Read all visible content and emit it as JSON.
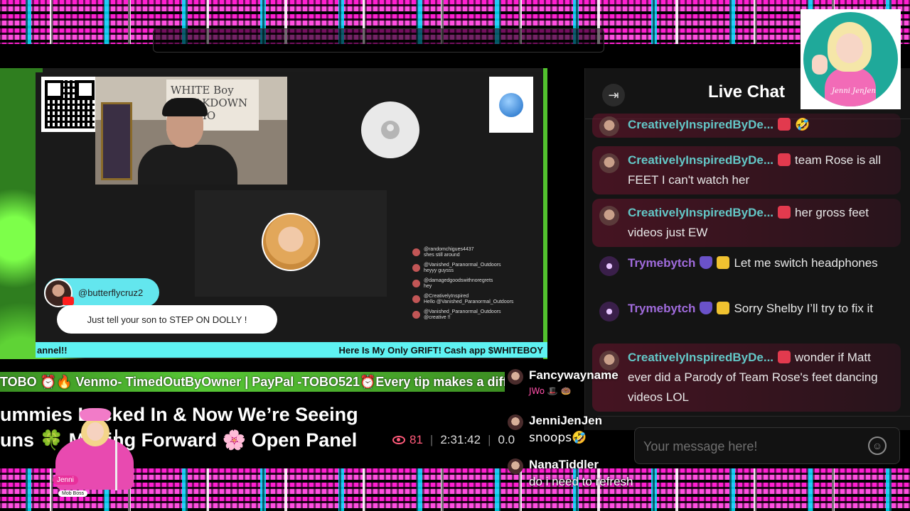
{
  "stream": {
    "name_bubble": "@butterflycruz2",
    "caption": "Just tell your son to STEP ON DOLLY !",
    "ticker_left": "annel!!",
    "ticker_right": "Here Is My Only GRIFT! Cash app $WHITEBOY",
    "cam_sign": "WHITE Boy BREAKDOWN STUDIO",
    "mini_chat": [
      {
        "user": "@randomchigues4437",
        "text": "shes still around"
      },
      {
        "user": "@Vanished_Paranormal_Outdoors",
        "text": "heyyy guysss"
      },
      {
        "user": "@damagedgoodswithnoregrets",
        "text": "hey"
      },
      {
        "user": "@CreativelyInspired",
        "text": "Hello @Vanished_Paranormal_Outdoors"
      },
      {
        "user": "@Vanished_Paranormal_Outdoors",
        "text": "@creative !!"
      }
    ]
  },
  "green_ticker": "TOBO ⏰🔥 Venmo- TimedOutByOwner | PayPal -TOBO521⏰Every tip makes a diffe",
  "title": {
    "line1": "ummies Locked In & Now We’re Seeing",
    "line2": "uns 🍀 Moving Forward 🌸 Open Panel"
  },
  "stats": {
    "viewers": "81",
    "duration": "2:31:42",
    "extra": "0.0"
  },
  "mob_badge": {
    "name": "Jenni",
    "role": "Mob Boss"
  },
  "logo": {
    "signature": "Jenni JenJen"
  },
  "chat": {
    "title": "Live Chat",
    "messages": [
      {
        "user": "CreativelyInspiredByDe...",
        "text": "🤣",
        "kind": "ci",
        "highlight": true
      },
      {
        "user": "CreativelyInspiredByDe...",
        "text": "team Rose is all FEET I can't watch her",
        "kind": "ci",
        "highlight": true
      },
      {
        "user": "CreativelyInspiredByDe...",
        "text": "her gross feet videos just EW",
        "kind": "ci",
        "highlight": true
      },
      {
        "user": "Trymebytch",
        "text": "Let me switch headphones",
        "kind": "tb",
        "highlight": false
      },
      {
        "user": "Trymebytch",
        "text": "Sorry Shelby I’ll try to fix it",
        "kind": "tb",
        "highlight": false
      },
      {
        "user": "CreativelyInspiredByDe...",
        "text": "wonder if Matt ever did a Parody of Team Rose's feet dancing videos LOL",
        "kind": "ci",
        "highlight": true
      }
    ],
    "input_placeholder": "Your message here!"
  },
  "overlay_chat": [
    {
      "user": "Fancywayname",
      "text": "",
      "icons": "JWo 🎩 🍩"
    },
    {
      "user": "JenniJenJen",
      "text": "snoops🤣"
    },
    {
      "user": "NanaTiddler",
      "text": "do i need to refresh"
    }
  ],
  "colors": {
    "accent_pink": "#ff1fd1",
    "accent_cyan": "#5ef2f2",
    "user_ci": "#63c7c7",
    "user_tb": "#a06bdc",
    "viewers": "#ff5a7a"
  }
}
